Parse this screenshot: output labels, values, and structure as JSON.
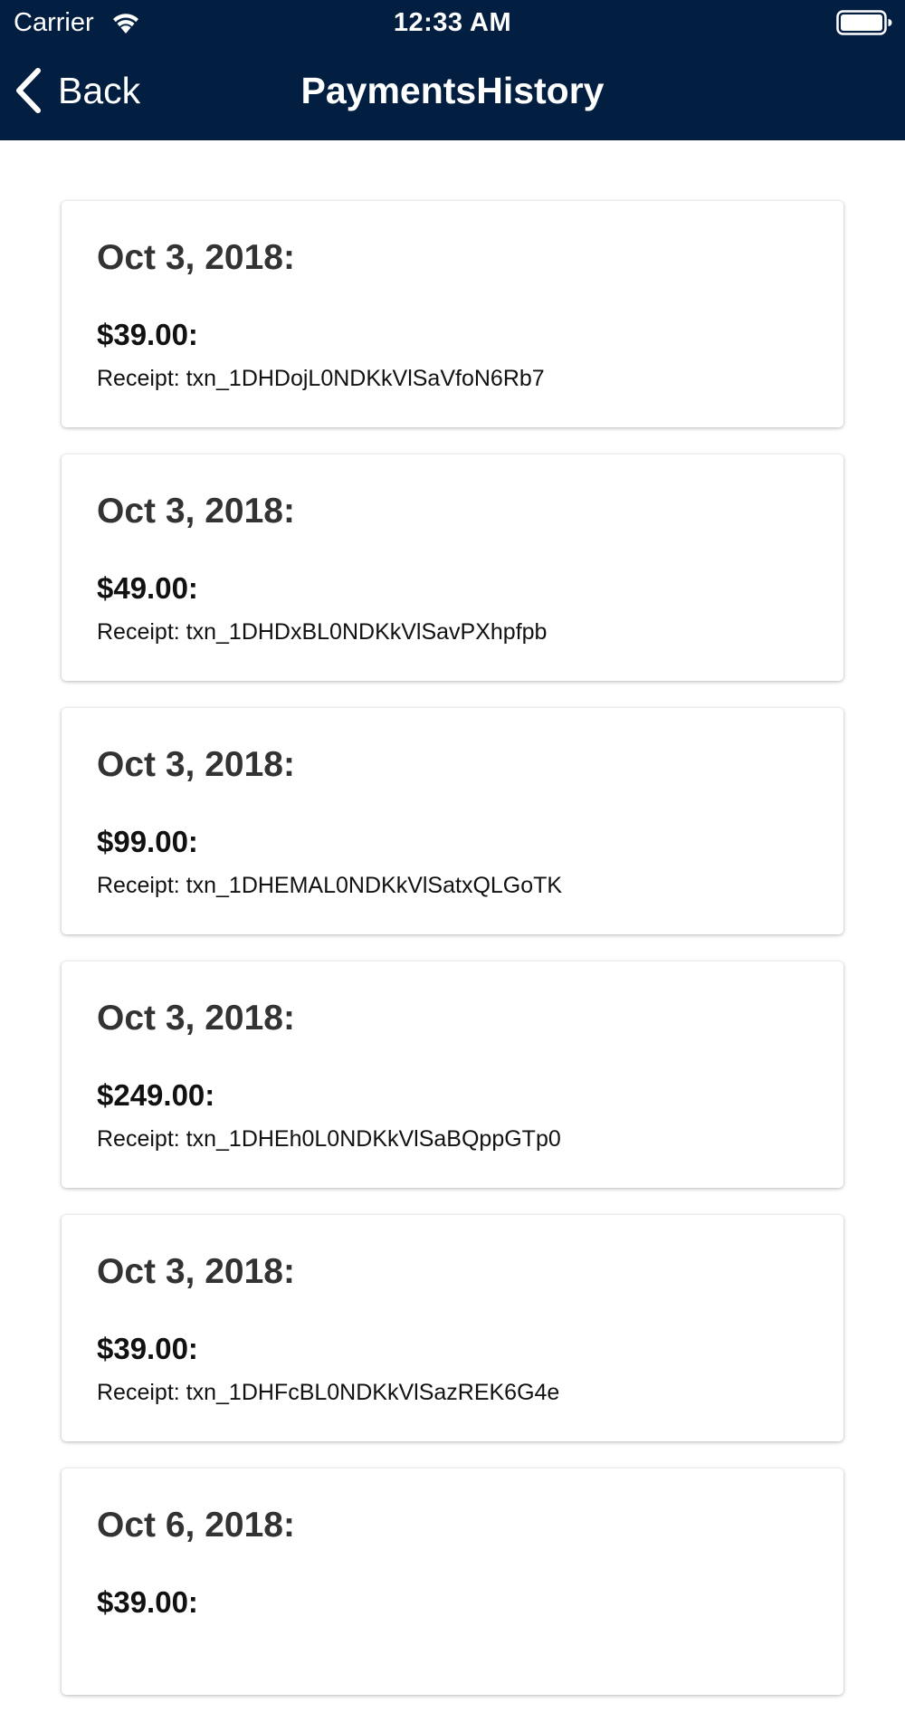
{
  "status_bar": {
    "carrier": "Carrier",
    "time": "12:33 AM",
    "wifi_icon": "wifi-icon",
    "battery_icon": "battery-full-icon"
  },
  "nav": {
    "back_label": "Back",
    "title": "PaymentsHistory",
    "background_color": "#021e40"
  },
  "payments": [
    {
      "date": "Oct 3, 2018:",
      "amount": "$39.00:",
      "receipt": "Receipt: txn_1DHDojL0NDKkVlSaVfoN6Rb7"
    },
    {
      "date": "Oct 3, 2018:",
      "amount": "$49.00:",
      "receipt": "Receipt: txn_1DHDxBL0NDKkVlSavPXhpfpb"
    },
    {
      "date": "Oct 3, 2018:",
      "amount": "$99.00:",
      "receipt": "Receipt: txn_1DHEMAL0NDKkVlSatxQLGoTK"
    },
    {
      "date": "Oct 3, 2018:",
      "amount": "$249.00:",
      "receipt": "Receipt: txn_1DHEh0L0NDKkVlSaBQppGTp0"
    },
    {
      "date": "Oct 3, 2018:",
      "amount": "$39.00:",
      "receipt": "Receipt: txn_1DHFcBL0NDKkVlSazREK6G4e"
    },
    {
      "date": "Oct 6, 2018:",
      "amount": "$39.00:",
      "receipt": ""
    }
  ]
}
